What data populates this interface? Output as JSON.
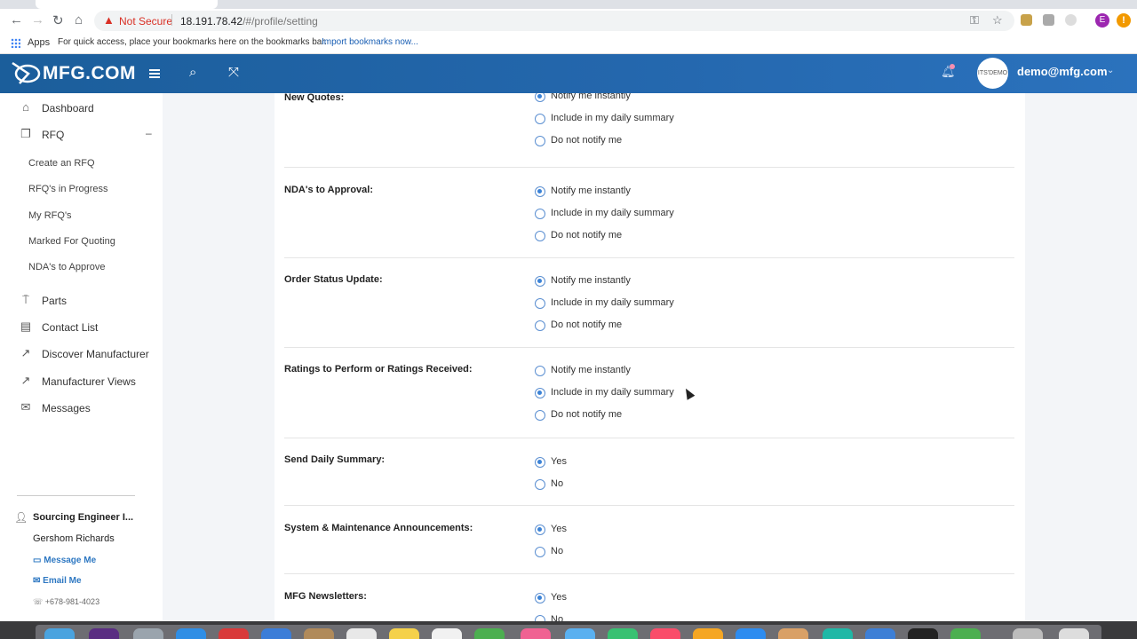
{
  "browser": {
    "not_secure": "Not Secure",
    "url_host": "18.191.78.42",
    "url_path": "/#/profile/setting",
    "profile_initial": "E"
  },
  "bookmarks": {
    "apps": "Apps",
    "hint": "For quick access, place your bookmarks here on the bookmarks bar.",
    "import": "Import bookmarks now..."
  },
  "header": {
    "logo": "MFG.COM",
    "avatar_text": "ITS'DEMO",
    "user_email": "demo@mfg.com"
  },
  "sidebar": {
    "items": [
      {
        "label": "Dashboard",
        "icon": "home-icon"
      },
      {
        "label": "RFQ",
        "icon": "document-icon"
      },
      {
        "label": "Parts",
        "icon": "pin-icon"
      },
      {
        "label": "Contact List",
        "icon": "list-icon"
      },
      {
        "label": "Discover Manufacturer",
        "icon": "wand-icon"
      },
      {
        "label": "Manufacturer Views",
        "icon": "wand-icon"
      },
      {
        "label": "Messages",
        "icon": "envelope-icon"
      }
    ],
    "rfq_sub": [
      "Create an RFQ",
      "RFQ's in Progress",
      "My RFQ's",
      "Marked For Quoting",
      "NDA's to Approve"
    ],
    "engineer": {
      "title": "Sourcing Engineer I...",
      "name": "Gershom Richards",
      "message": "Message Me",
      "email": "Email Me",
      "phone": "+678-981-4023"
    }
  },
  "settings": {
    "sections": [
      {
        "label": "New Quotes:",
        "options": [
          "Notify me instantly",
          "Include in my daily summary",
          "Do not notify me"
        ],
        "selected": 0
      },
      {
        "label": "NDA's to Approval:",
        "options": [
          "Notify me instantly",
          "Include in my daily summary",
          "Do not notify me"
        ],
        "selected": 0
      },
      {
        "label": "Order Status Update:",
        "options": [
          "Notify me instantly",
          "Include in my daily summary",
          "Do not notify me"
        ],
        "selected": 0
      },
      {
        "label": "Ratings to Perform or Ratings Received:",
        "options": [
          "Notify me instantly",
          "Include in my daily summary",
          "Do not notify me"
        ],
        "selected": 1
      },
      {
        "label": "Send Daily Summary:",
        "options": [
          "Yes",
          "No"
        ],
        "selected": 0
      },
      {
        "label": "System & Maintenance Announcements:",
        "options": [
          "Yes",
          "No"
        ],
        "selected": 0
      },
      {
        "label": "MFG Newsletters:",
        "options": [
          "Yes",
          "No"
        ],
        "selected": 0
      }
    ]
  },
  "colors": {
    "header": "#2467ad",
    "radio": "#3b82d6",
    "link": "#2e78c2"
  }
}
